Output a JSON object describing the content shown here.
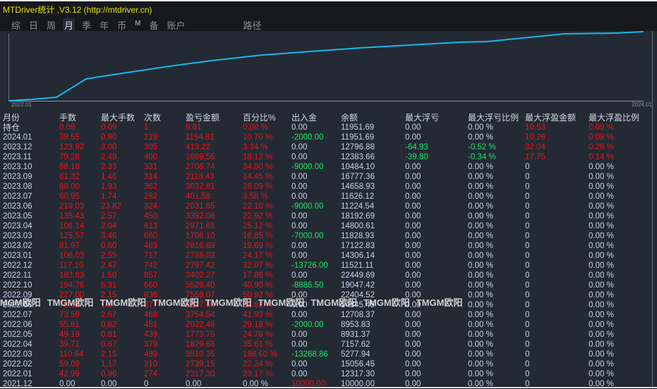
{
  "title": "MTDriver统计 ,V3.12 (http://mtdriver.cn)",
  "tabs": [
    "综",
    "日",
    "周",
    "月",
    "季",
    "年",
    "币",
    "M",
    "备",
    "账户",
    "路径"
  ],
  "active_tab": "月",
  "chart": {
    "x_start": "2022.01",
    "x_end": "2024.01",
    "line_color": "#16b8f3"
  },
  "colors": {
    "red": "#e8141c",
    "green": "#19e66a",
    "neutral": "#c4d2e8",
    "header": "#cfd6df"
  },
  "watermark": "TMGM欧阳",
  "columns": [
    "月份",
    "手数",
    "最大手数",
    "次数",
    "盈亏金额",
    "百分比%",
    "出入金",
    "余额",
    "最大浮亏",
    "最大浮亏比例",
    "最大浮盈金额",
    "最大浮盈比例"
  ],
  "rows": [
    [
      "持仓",
      "0.09",
      "0.09",
      "1",
      "9.81",
      "0.08 %",
      "0.00",
      "11951.69",
      "0.00",
      "0.00 %",
      "10.53",
      "0.09 %"
    ],
    [
      "2024.01",
      "39.55",
      "0.90",
      "219",
      "1154.81",
      "10.70 %",
      "-2000.00",
      "11951.69",
      "0.00",
      "0.00 %",
      "10.26",
      "0.09 %"
    ],
    [
      "2023.12",
      "123.92",
      "3.00",
      "305",
      "413.22",
      "3.34 %",
      "0.00",
      "12796.88",
      "-64.93",
      "-0.52 %",
      "32.04",
      "0.26 %"
    ],
    [
      "2023.11",
      "79.28",
      "2.49",
      "400",
      "1899.56",
      "18.12 %",
      "0.00",
      "12383.66",
      "-39.80",
      "-0.34 %",
      "17.75",
      "0.14 %"
    ],
    [
      "2023.10",
      "88.18",
      "2.33",
      "331",
      "2706.74",
      "34.80 %",
      "-9000.00",
      "10484.10",
      "0.00",
      "0.00 %",
      "0",
      "0.00 %"
    ],
    [
      "2023.09",
      "81.32",
      "1.46",
      "314",
      "2118.43",
      "14.45 %",
      "0.00",
      "16777.36",
      "0.00",
      "0.00 %",
      "0",
      "0.00 %"
    ],
    [
      "2023.08",
      "88.00",
      "1.93",
      "362",
      "3032.81",
      "26.09 %",
      "0.00",
      "14658.93",
      "0.00",
      "0.00 %",
      "0",
      "0.00 %"
    ],
    [
      "2023.07",
      "60.95",
      "1.74",
      "282",
      "401.58",
      "3.58 %",
      "0.00",
      "11626.12",
      "0.00",
      "0.00 %",
      "0",
      "0.00 %"
    ],
    [
      "2023.06",
      "219.03",
      "23.82",
      "324",
      "2031.85",
      "22.10 %",
      "-9000.00",
      "11224.54",
      "0.00",
      "0.00 %",
      "0",
      "0.00 %"
    ],
    [
      "2023.05",
      "135.43",
      "2.57",
      "450",
      "3392.08",
      "22.92 %",
      "0.00",
      "18192.69",
      "0.00",
      "0.00 %",
      "0",
      "0.00 %"
    ],
    [
      "2023.04",
      "106.14",
      "2.04",
      "613",
      "2971.68",
      "25.12 %",
      "0.00",
      "14800.61",
      "0.00",
      "0.00 %",
      "0",
      "0.00 %"
    ],
    [
      "2023.03",
      "125.57",
      "3.46",
      "660",
      "1706.10",
      "16.85 %",
      "-7000.00",
      "11828.93",
      "0.00",
      "0.00 %",
      "0",
      "0.00 %"
    ],
    [
      "2023.02",
      "81.97",
      "0.60",
      "489",
      "2816.69",
      "19.69 %",
      "0.00",
      "17122.83",
      "0.00",
      "0.00 %",
      "0",
      "0.00 %"
    ],
    [
      "2023.01",
      "106.03",
      "2.55",
      "717",
      "2785.03",
      "24.17 %",
      "0.00",
      "14306.14",
      "0.00",
      "0.00 %",
      "0",
      "0.00 %"
    ],
    [
      "2022.12",
      "117.10",
      "2.47",
      "742",
      "2797.42",
      "32.07 %",
      "-13726.00",
      "11521.11",
      "0.00",
      "0.00 %",
      "0",
      "0.00 %"
    ],
    [
      "2022.11",
      "183.83",
      "1.50",
      "857",
      "3402.27",
      "17.86 %",
      "0.00",
      "22449.69",
      "0.00",
      "0.00 %",
      "0",
      "0.00 %"
    ],
    [
      "2022.10",
      "194.76",
      "5.31",
      "660",
      "5529.40",
      "40.90 %",
      "-8886.50",
      "19047.42",
      "0.00",
      "0.00 %",
      "0",
      "0.00 %"
    ],
    [
      "2022.09",
      "227.00",
      "2.15",
      "836",
      "7559.07",
      "50.92 %",
      "0.00",
      "22404.52",
      "0.00",
      "0.00 %",
      "0",
      "0.00 %"
    ],
    [
      "2022.08",
      "78.62",
      "1.34",
      "377",
      "2137.08",
      "16.82 %",
      "0.00",
      "14845.45",
      "0.00",
      "0.00 %",
      "0",
      "0.00 %"
    ],
    [
      "2022.07",
      "73.59",
      "2.67",
      "468",
      "3754.54",
      "41.93 %",
      "0.00",
      "12708.37",
      "0.00",
      "0.00 %",
      "0",
      "0.00 %"
    ],
    [
      "2022.06",
      "55.61",
      "0.82",
      "451",
      "2022.46",
      "29.18 %",
      "-2000.00",
      "8953.83",
      "0.00",
      "0.00 %",
      "0",
      "0.00 %"
    ],
    [
      "2022.05",
      "49.19",
      "0.81",
      "439",
      "1773.75",
      "24.78 %",
      "0.00",
      "8931.37",
      "0.00",
      "0.00 %",
      "0",
      "0.00 %"
    ],
    [
      "2022.04",
      "39.71",
      "0.67",
      "379",
      "1879.68",
      "35.61 %",
      "0.00",
      "7157.62",
      "0.00",
      "0.00 %",
      "0",
      "0.00 %"
    ],
    [
      "2022.03",
      "110.64",
      "2.15",
      "489",
      "3510.35",
      "198.60 %",
      "-13288.86",
      "5277.94",
      "0.00",
      "0.00 %",
      "0",
      "0.00 %"
    ],
    [
      "2022.02",
      "59.09",
      "1.17",
      "310",
      "2739.15",
      "22.24 %",
      "0.00",
      "15056.45",
      "0.00",
      "0.00 %",
      "0",
      "0.00 %"
    ],
    [
      "2022.01",
      "42.99",
      "0.96",
      "274",
      "2317.30",
      "23.17 %",
      "0.00",
      "12317.30",
      "0.00",
      "0.00 %",
      "0",
      "0.00 %"
    ],
    [
      "2021.12",
      "0.00",
      "0.00",
      "0",
      "0.00",
      "0.00 %",
      "10000.00",
      "10000.00",
      "0.00",
      "0.00 %",
      "0",
      "0.00 %"
    ]
  ]
}
